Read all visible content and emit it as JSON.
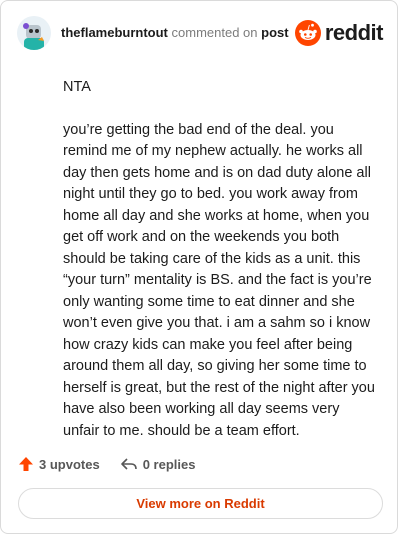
{
  "comment": {
    "username": "theflameburntout",
    "action": "commented on",
    "post_link": "post",
    "paragraphs": [
      "NTA",
      "you’re getting the bad end of the deal. you remind me of my nephew actually. he works all day then gets home and is on dad duty alone all night until they go to bed. you work away from home all day and she works at home, when you get off work and on the weekends you both should be taking care of the kids as a unit. this “your turn” mentality is BS. and the fact is you’re only wanting some time to eat dinner and she won’t even give you that. i am a sahm so i know how crazy kids can make you feel after being around them all day, so giving her some time to herself is great, but the rest of the night after you have also been working all day seems very unfair to me. should be a team effort."
    ],
    "upvotes": "3 upvotes",
    "replies": "0 replies"
  },
  "brand": {
    "name": "reddit",
    "color": "#ff4500"
  },
  "actions": {
    "view_more": "View more on Reddit"
  },
  "icons": {
    "avatar": "user-avatar",
    "logo": "reddit-logo-icon",
    "upvote": "upvote-arrow-icon",
    "reply": "reply-arrow-icon"
  },
  "colors": {
    "accent": "#d93a00",
    "upvote": "#ff4500"
  }
}
